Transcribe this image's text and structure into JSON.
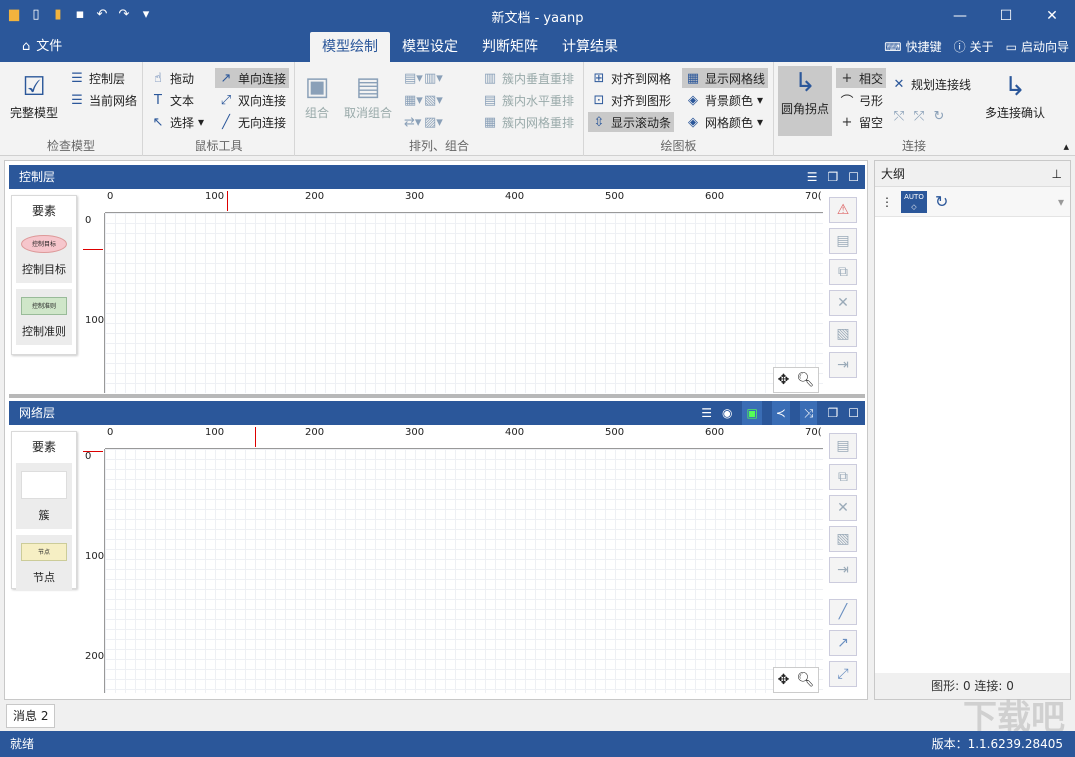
{
  "window": {
    "title": "新文档 - yaanp",
    "minimize": "—",
    "maximize": "☐",
    "close": "✕"
  },
  "menu": {
    "file_label": "文件",
    "tabs": [
      {
        "label": "模型绘制",
        "active": true
      },
      {
        "label": "模型设定",
        "active": false
      },
      {
        "label": "判断矩阵",
        "active": false
      },
      {
        "label": "计算结果",
        "active": false
      }
    ],
    "shortcut_label": "快捷键",
    "about_label": "关于",
    "wizard_label": "启动向导"
  },
  "ribbon": {
    "check": {
      "full_model": "完整模型",
      "control_layer": "控制层",
      "current_network": "当前网络",
      "group_label": "检查模型"
    },
    "mouse": {
      "drag": "拖动",
      "text": "文本",
      "select": "选择",
      "one_way": "单向连接",
      "two_way": "双向连接",
      "no_dir": "无向连接",
      "group_label": "鼠标工具"
    },
    "arrange": {
      "combine": "组合",
      "uncombine": "取消组合",
      "vert": "簇内垂直重排",
      "horz": "簇内水平重排",
      "grid": "簇内网格重排",
      "group_label": "排列、组合"
    },
    "canvas": {
      "align_grid": "对齐到网格",
      "align_shape": "对齐到图形",
      "show_scroll": "显示滚动条",
      "show_grid": "显示网格线",
      "bg_color": "背景颜色",
      "grid_color": "网格颜色",
      "group_label": "绘图板"
    },
    "connect": {
      "round_corner": "圆角拐点",
      "intersect": "相交",
      "arc": "弓形",
      "gap": "留空",
      "plan_lines": "规划连接线",
      "multi_confirm": "多连接确认",
      "group_label": "连接"
    }
  },
  "control_layer": {
    "title": "控制层",
    "palette_title": "要素",
    "items": [
      {
        "label": "控制目标",
        "shape_text": "控制目标"
      },
      {
        "label": "控制准则",
        "shape_text": "控制准则"
      }
    ]
  },
  "network_layer": {
    "title": "网络层",
    "palette_title": "要素",
    "items": [
      {
        "label": "簇",
        "shape_text": ""
      },
      {
        "label": "节点",
        "shape_text": "节点"
      }
    ]
  },
  "ruler": {
    "h_ticks": [
      "0",
      "100",
      "200",
      "300",
      "400",
      "500",
      "600",
      "70("
    ],
    "v_ticks_control": [
      "0",
      "100"
    ],
    "v_ticks_network": [
      "0",
      "100",
      "200"
    ]
  },
  "outline": {
    "title": "大纲",
    "auto_label": "AUTO",
    "status": "图形: 0   连接: 0"
  },
  "messages": {
    "tab_label": "消息 2"
  },
  "status": {
    "left": "就绪",
    "version": "版本：1.1.6239.28405"
  },
  "colors": {
    "primary": "#2b579a",
    "ribbon_bg": "#f3f3f3",
    "selected": "#c9c9c9"
  }
}
